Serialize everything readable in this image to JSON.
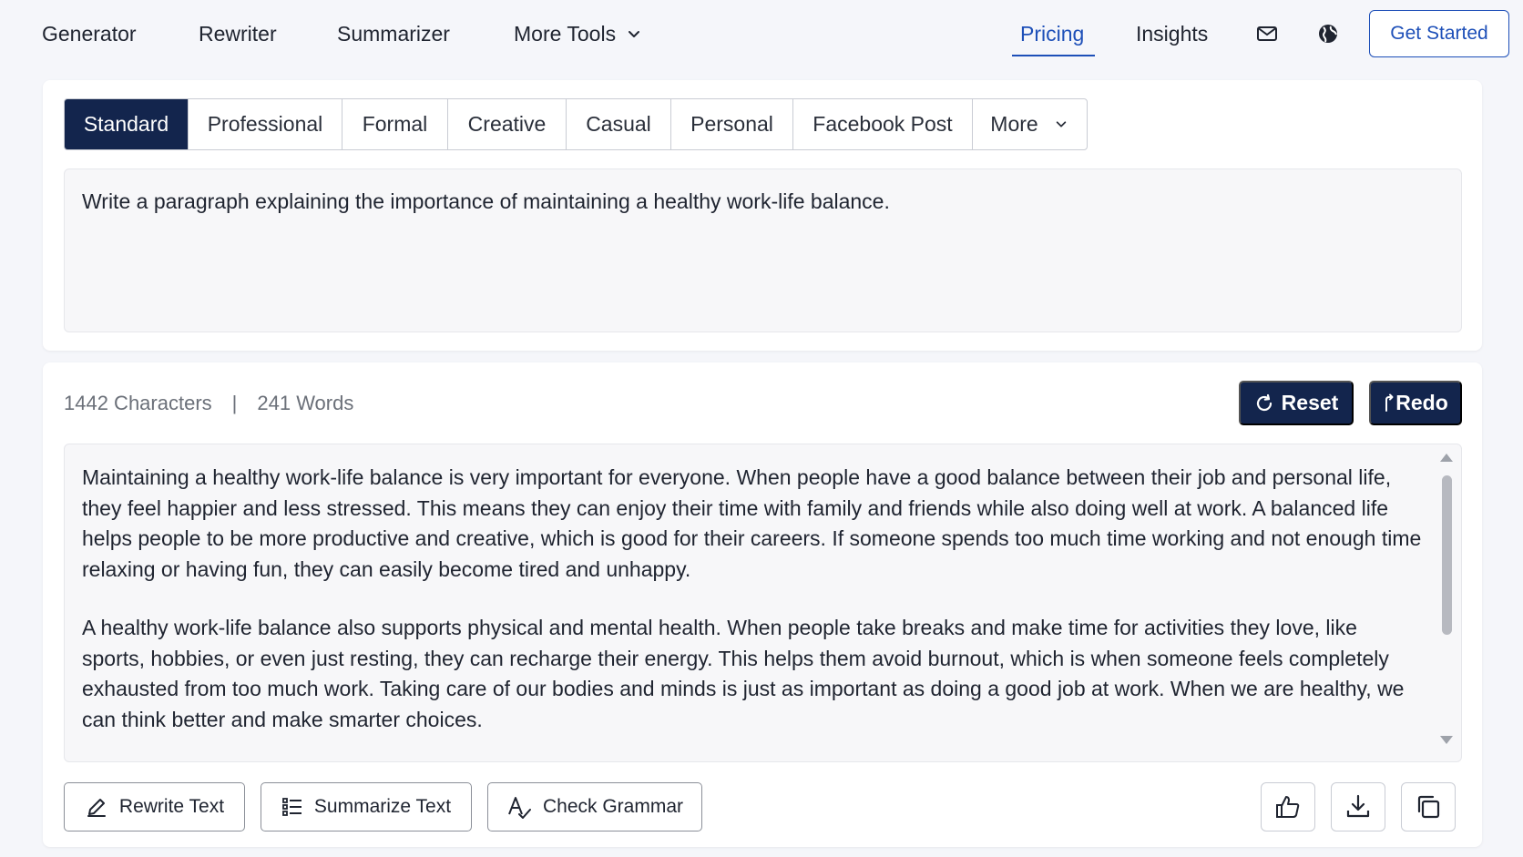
{
  "nav": {
    "links": [
      "Generator",
      "Rewriter",
      "Summarizer"
    ],
    "more_tools": "More Tools",
    "pricing": "Pricing",
    "insights": "Insights",
    "get_started": "Get Started",
    "icons": [
      "mail-icon",
      "globe-icon"
    ]
  },
  "tabs": {
    "items": [
      "Standard",
      "Professional",
      "Formal",
      "Creative",
      "Casual",
      "Personal",
      "Facebook Post"
    ],
    "more": "More",
    "active": "Standard"
  },
  "prompt": {
    "text": "Write a paragraph explaining the importance of maintaining a healthy work-life balance."
  },
  "output": {
    "characters": "1442 Characters",
    "separator": "|",
    "words": "241 Words",
    "reset_label": "Reset",
    "redo_label": "Redo",
    "paragraphs": [
      "Maintaining a healthy work-life balance is very important for everyone. When people have a good balance between their job and personal life, they feel happier and less stressed. This means they can enjoy their time with family and friends while also doing well at work. A balanced life helps people to be more productive and creative, which is good for their careers. If someone spends too much time working and not enough time relaxing or having fun, they can easily become tired and unhappy.",
      "A healthy work-life balance also supports physical and mental health. When people take breaks and make time for activities they love, like sports, hobbies, or even just resting, they can recharge their energy. This helps them avoid burnout, which is when someone feels completely exhausted from too much work. Taking care of our bodies and minds is just as important as doing a good job at work. When we are healthy, we can think better and make smarter choices."
    ]
  },
  "actions": {
    "rewrite": "Rewrite Text",
    "summarize": "Summarize Text",
    "grammar": "Check Grammar"
  },
  "colors": {
    "accent": "#1d4fb8",
    "dark_button": "#13254d",
    "background": "#f5f6fa"
  }
}
